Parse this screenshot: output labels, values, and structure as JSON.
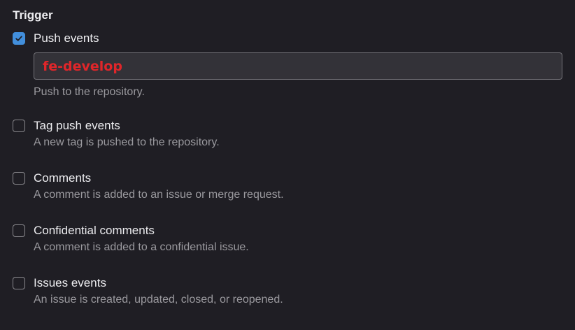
{
  "section": {
    "title": "Trigger"
  },
  "triggers": [
    {
      "label": "Push events",
      "checked": true,
      "branch_value": "fe-develop",
      "help": "Push to the repository."
    },
    {
      "label": "Tag push events",
      "checked": false,
      "help": "A new tag is pushed to the repository."
    },
    {
      "label": "Comments",
      "checked": false,
      "help": "A comment is added to an issue or merge request."
    },
    {
      "label": "Confidential comments",
      "checked": false,
      "help": "A comment is added to a confidential issue."
    },
    {
      "label": "Issues events",
      "checked": false,
      "help": "An issue is created, updated, closed, or reopened."
    }
  ],
  "colors": {
    "background": "#1f1e24",
    "checkbox_checked": "#428fdc",
    "branch_text": "#e0262a",
    "help_text": "#9a999e"
  }
}
